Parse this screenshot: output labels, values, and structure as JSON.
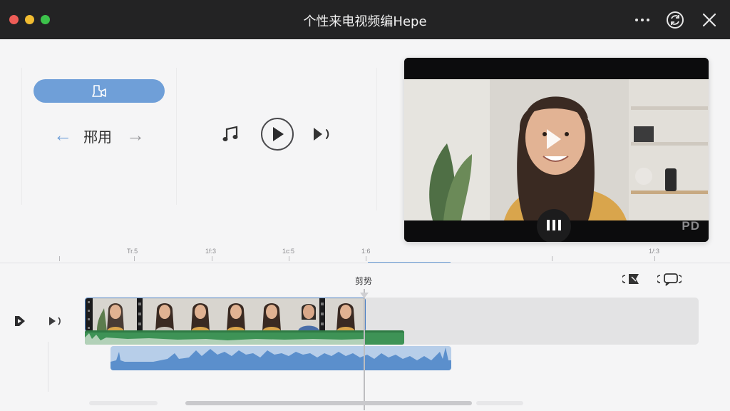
{
  "window": {
    "title": "个性来电视频编Hepe",
    "traffic_lights": {
      "close": "#ee5d57",
      "minimize": "#f1bc31",
      "maximize": "#3cc24b"
    },
    "icons": [
      "more-horizontal-icon",
      "sync-icon",
      "close-icon"
    ]
  },
  "left_panel": {
    "primary_button": {
      "icon": "camera-icon",
      "color": "#6f9fd8"
    },
    "nav": {
      "back_icon": "arrow-left-icon",
      "label": "郉用",
      "forward_icon": "arrow-right-icon"
    }
  },
  "controls": {
    "icons": [
      "music-note-icon",
      "play-icon",
      "play-sound-icon"
    ]
  },
  "preview": {
    "watermark": "PD",
    "overlay_icons": [
      "play-icon",
      "pause-icon"
    ]
  },
  "ruler": {
    "labels": [
      "Tr.5",
      "1f:3",
      "1c:5",
      "1:6",
      "1/:3"
    ],
    "progress_color": "#6f9fd8"
  },
  "timeline": {
    "playhead_label": "剪势",
    "tool_icons": [
      "split-icon",
      "caption-icon"
    ],
    "track_icons": [
      "track-video-icon",
      "track-audio-icon"
    ],
    "video_clip_frame_count": 8,
    "colors": {
      "video_border": "#4b7fc2",
      "audio": "#5b8fcc",
      "overlay": "#3e9356"
    }
  }
}
